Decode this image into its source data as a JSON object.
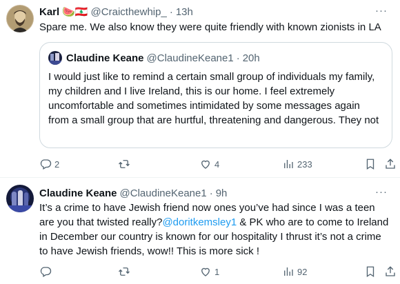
{
  "tweet1": {
    "name": "Karl",
    "flags": "🍉🇱🇧",
    "handle": "@Craicthewhip_",
    "time": "13h",
    "text": "Spare me. We also know they were quite friendly with known zionists in LA",
    "quote": {
      "name": "Claudine Keane",
      "handle": "@ClaudineKeane1",
      "time": "20h",
      "text": "I would just like to remind a certain small group of individuals my family, my children and I live Ireland, this is our home. I feel extremely uncomfortable and sometimes intimidated by some messages again from a small group that are hurtful, threatening and dangerous. They not"
    },
    "actions": {
      "replies": "2",
      "retweets": "",
      "likes": "4",
      "views": "233"
    }
  },
  "tweet2": {
    "name": "Claudine Keane",
    "handle": "@ClaudineKeane1",
    "time": "9h",
    "text_before": "It’s a crime to have Jewish friend now ones you’ve had since I was a teen are you that twisted really?",
    "mention": "@doritkemsley1",
    "text_after": " & PK who are to come to Ireland in December our country is known for our hospitality  I thrust it’s not a crime to have Jewish friends, wow!! This is more sick !",
    "actions": {
      "replies": "",
      "retweets": "",
      "likes": "1",
      "views": "92"
    }
  },
  "common": {
    "dot": "·",
    "more": "···"
  },
  "colors": {
    "text": "#0f1419",
    "secondary": "#536471",
    "link": "#1d9bf0",
    "border": "#cfd9de"
  },
  "icons": [
    "reply-icon",
    "retweet-icon",
    "like-icon",
    "views-icon",
    "bookmark-icon",
    "share-icon",
    "more-icon"
  ]
}
